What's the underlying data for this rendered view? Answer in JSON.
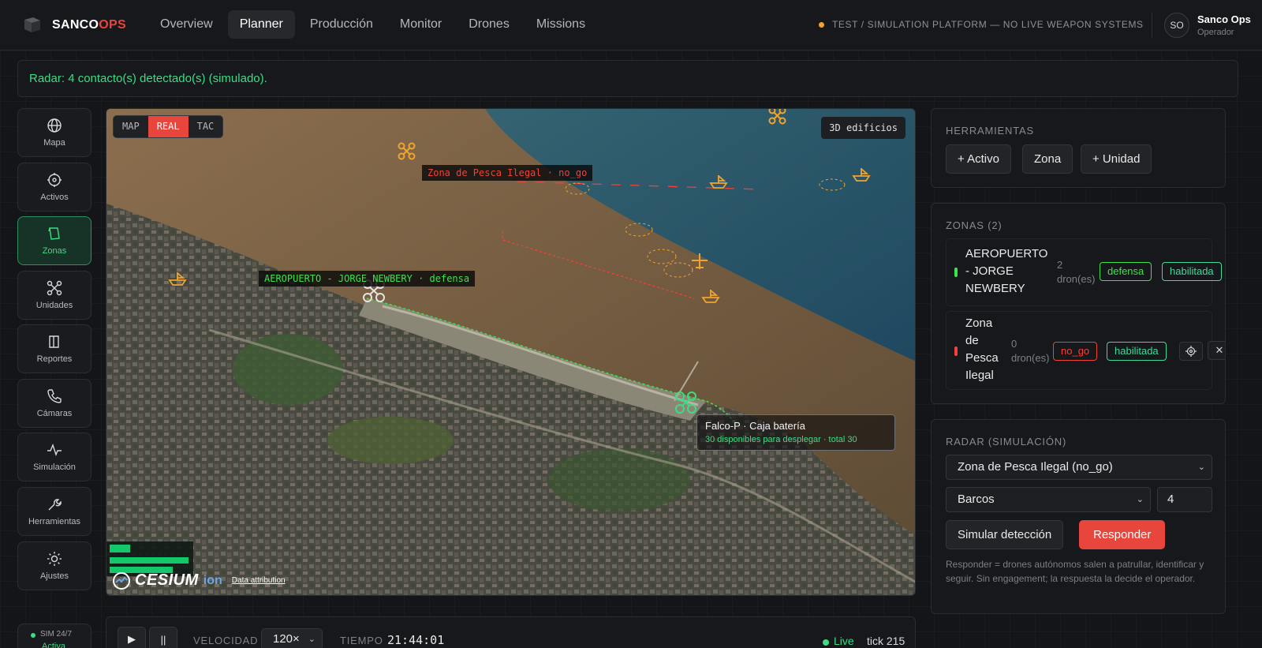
{
  "brand": {
    "name": "SANCO",
    "accent": "OPS"
  },
  "nav": {
    "tabs": [
      {
        "label": "Overview",
        "active": false
      },
      {
        "label": "Planner",
        "active": true
      },
      {
        "label": "Producción",
        "active": false
      },
      {
        "label": "Monitor",
        "active": false
      },
      {
        "label": "Drones",
        "active": false
      },
      {
        "label": "Missions",
        "active": false
      }
    ]
  },
  "warning": {
    "text": "TEST / SIMULATION PLATFORM — NO LIVE WEAPON SYSTEMS"
  },
  "user": {
    "initials": "SO",
    "name": "Sanco Ops",
    "role": "Operador"
  },
  "alert": {
    "text": "Radar: 4 contacto(s) detectado(s) (simulado)."
  },
  "sidebar": {
    "items": [
      {
        "label": "Mapa",
        "icon": "globe-icon",
        "active": false
      },
      {
        "label": "Activos",
        "icon": "crosshair-icon",
        "active": false
      },
      {
        "label": "Zonas",
        "icon": "map-pin-icon",
        "active": true
      },
      {
        "label": "Unidades",
        "icon": "drone-icon",
        "active": false
      },
      {
        "label": "Reportes",
        "icon": "book-icon",
        "active": false
      },
      {
        "label": "Cámaras",
        "icon": "phone-icon",
        "active": false
      },
      {
        "label": "Simulación",
        "icon": "activity-icon",
        "active": false
      },
      {
        "label": "Herramientas",
        "icon": "wrench-icon",
        "active": false
      },
      {
        "label": "Ajustes",
        "icon": "sun-icon",
        "active": false
      }
    ],
    "sim": {
      "title": "SIM 24/7",
      "state": "Activa"
    }
  },
  "map": {
    "modes": [
      {
        "label": "MAP",
        "active": false
      },
      {
        "label": "REAL",
        "active": true
      },
      {
        "label": "TAC",
        "active": false
      }
    ],
    "buildings_button": "3D edificios",
    "zone_labels": {
      "no_go": "Zona de Pesca Ilegal · no_go",
      "defensa": "AEROPUERTO - JORGE NEWBERY  · defensa"
    },
    "unit_card": {
      "title": "Falco-P · Caja batería",
      "subtitle": "30 disponibles para desplegar · total 30"
    },
    "attribution": {
      "logo": "CESIUM",
      "ion": "ion",
      "link": "Data attribution"
    },
    "colors": {
      "no_go": "#f0423a",
      "defensa": "#3ee34c",
      "contact": "#f0a430"
    }
  },
  "playback": {
    "play_label": "▶",
    "pause_label": "||",
    "speed_label": "VELOCIDAD",
    "speed_value": "120×",
    "time_label": "TIEMPO",
    "time_value": "21:44:01",
    "live_label": "Live",
    "tick_label": "tick 215"
  },
  "tools": {
    "title": "HERRAMIENTAS",
    "buttons": [
      "+ Activo",
      "Zona",
      "+ Unidad"
    ]
  },
  "zones": {
    "title": "ZONAS (2)",
    "items": [
      {
        "name": "AEROPUERTO - JORGE NEWBERY",
        "count": "2 dron(es)",
        "type": "defensa",
        "status": "habilitada",
        "color": "#3ee34c"
      },
      {
        "name": "Zona de Pesca Ilegal",
        "count": "0 dron(es)",
        "type": "no_go",
        "status": "habilitada",
        "color": "#f0423a"
      }
    ]
  },
  "radar": {
    "title": "RADAR (SIMULACIÓN)",
    "zone_select": "Zona de Pesca Ilegal (no_go)",
    "target_select": "Barcos",
    "count": "4",
    "simulate_label": "Simular detección",
    "respond_label": "Responder",
    "note": "Responder = drones autónomos salen a patrullar, identificar y seguir. Sin engagement; la respuesta la decide el operador."
  },
  "accent_color": "#e8453c"
}
